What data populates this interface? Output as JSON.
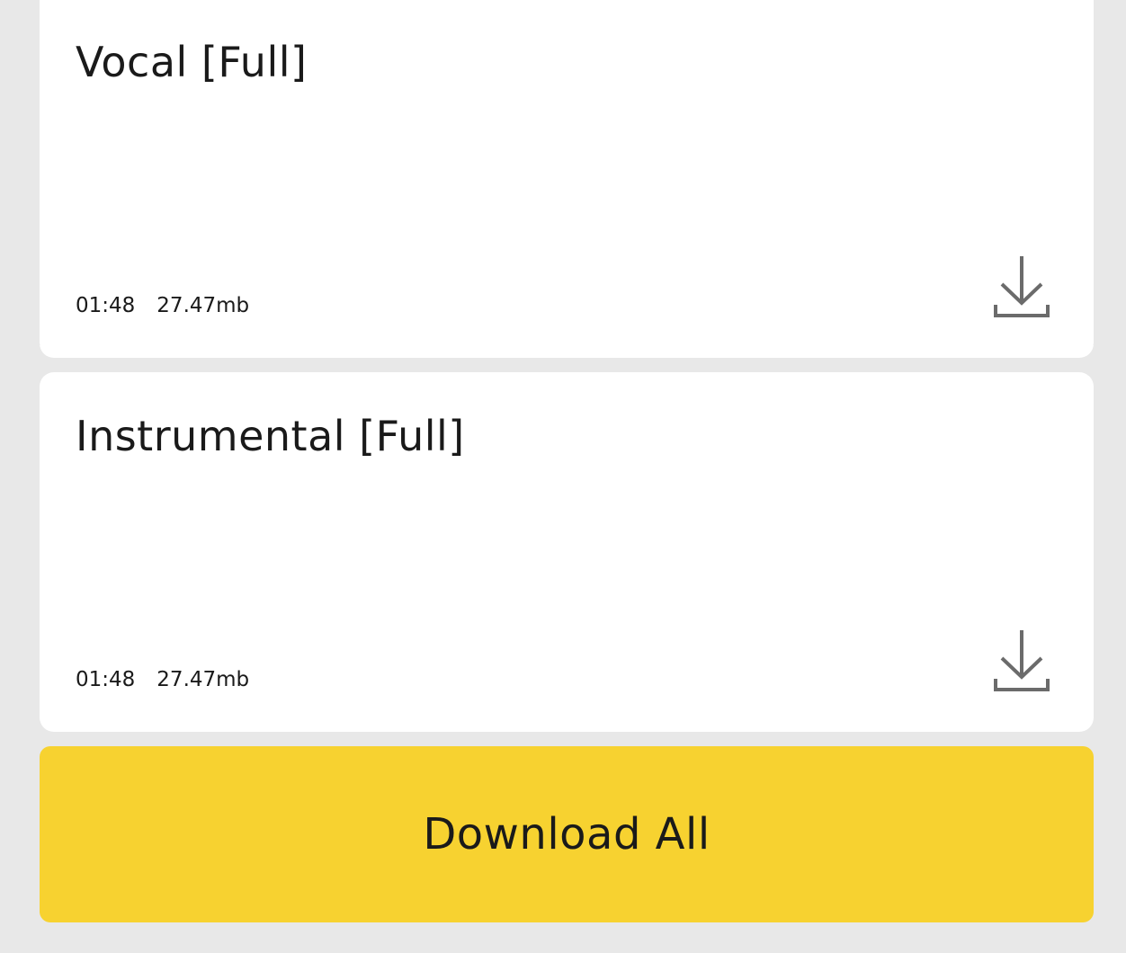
{
  "tracks": [
    {
      "title": "Vocal [Full]",
      "duration": "01:48",
      "size": "27.47mb",
      "download_icon": "download-icon"
    },
    {
      "title": "Instrumental [Full]",
      "duration": "01:48",
      "size": "27.47mb",
      "download_icon": "download-icon"
    }
  ],
  "download_all_label": "Download All",
  "colors": {
    "background": "#e8e8e8",
    "card": "#ffffff",
    "accent": "#f7d230",
    "text": "#1a1a1a",
    "icon": "#6b6b6b"
  }
}
